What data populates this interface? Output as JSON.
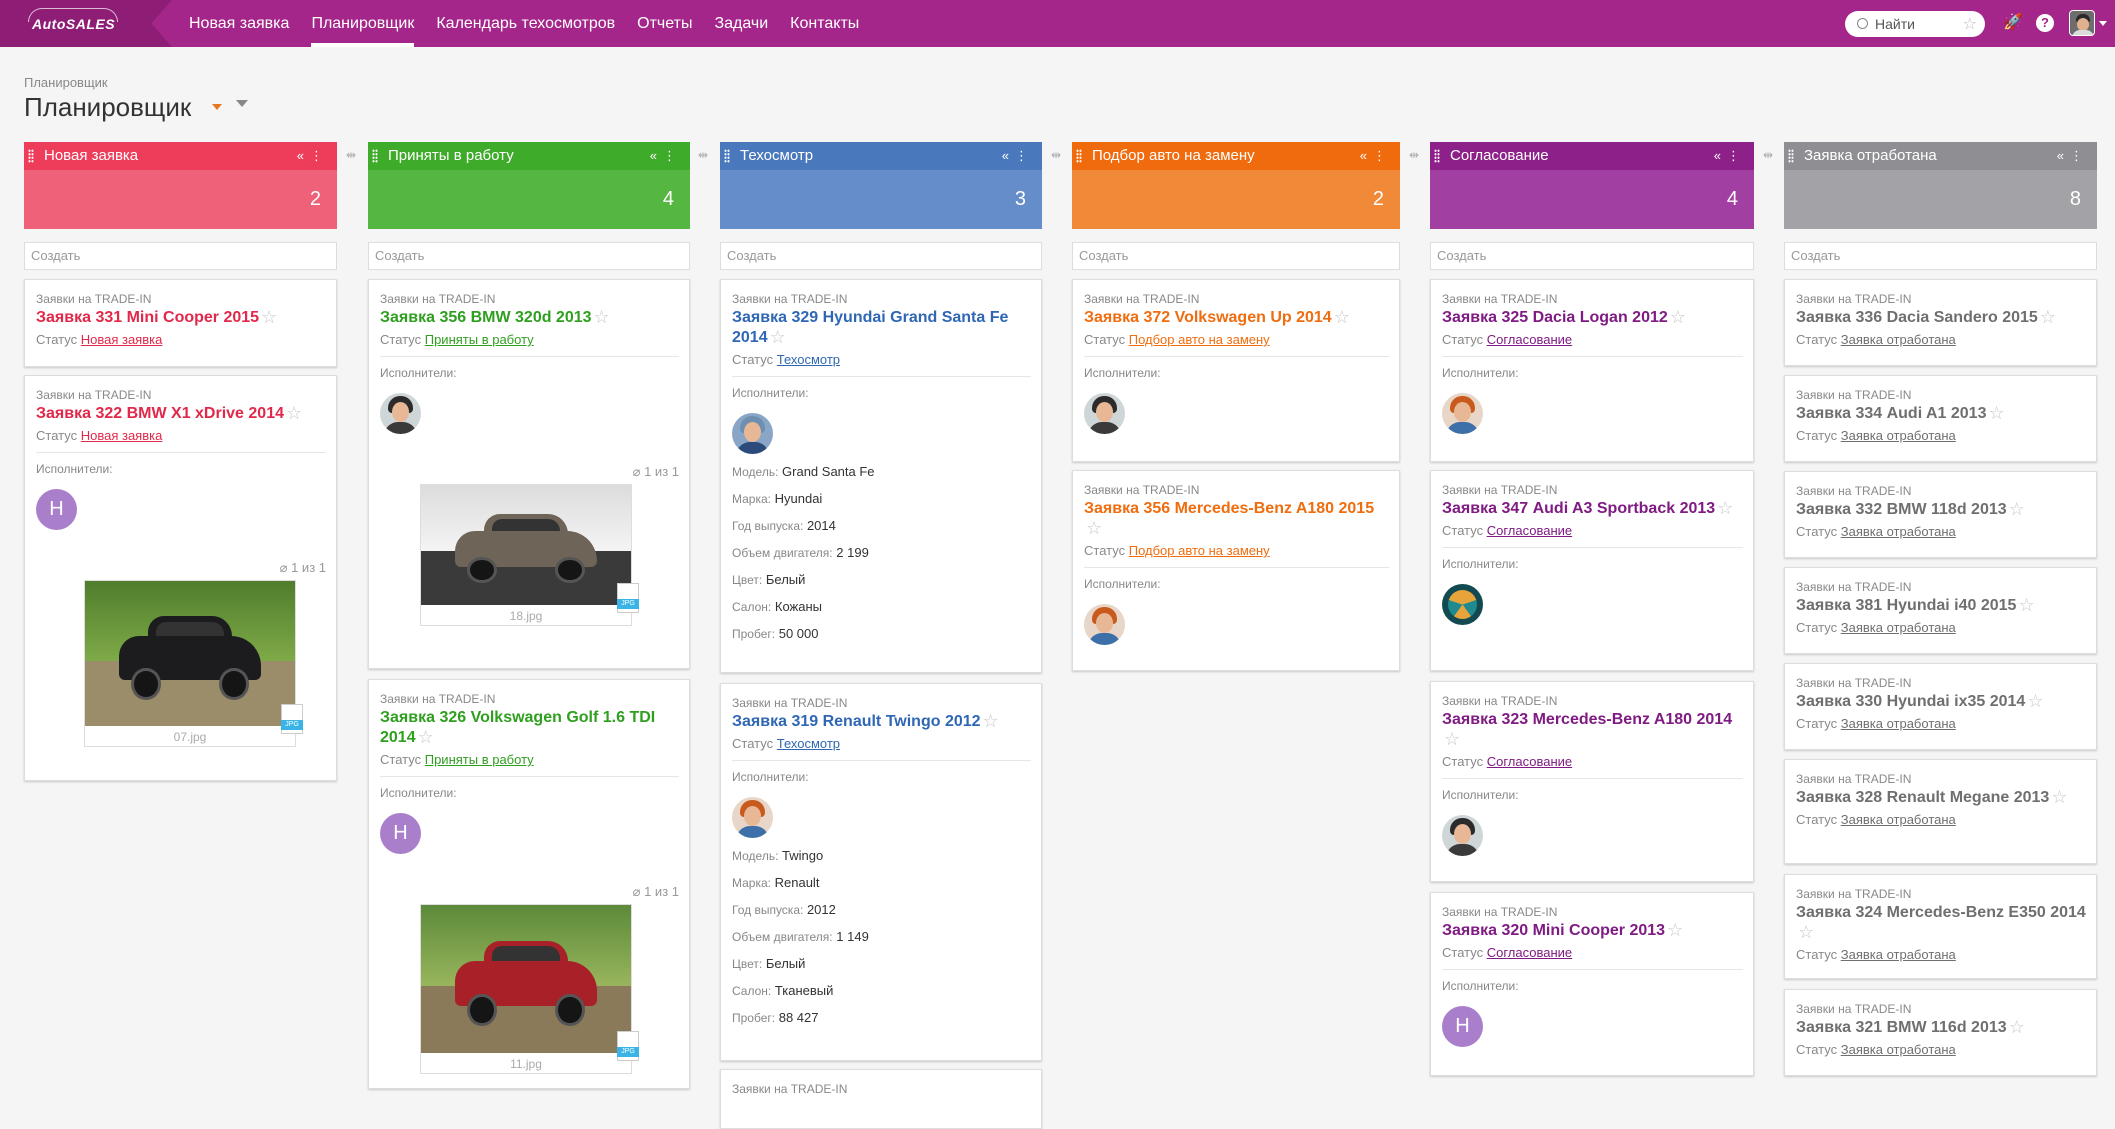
{
  "app": {
    "logo": "AutoSALES"
  },
  "nav": [
    "Новая заявка",
    "Планировщик",
    "Календарь техосмотров",
    "Отчеты",
    "Задачи",
    "Контакты"
  ],
  "search": {
    "label": "Найти"
  },
  "page": {
    "breadcrumb": "Планировщик",
    "title": "Планировщик"
  },
  "create_label": "Создать",
  "labels": {
    "status": "Статус",
    "executors": "Исполнители:",
    "model": "Модель:",
    "brand": "Марка:",
    "year": "Год выпуска:",
    "engine": "Объем двигателя:",
    "color": "Цвет:",
    "salon": "Салон:",
    "mileage": "Пробег:"
  },
  "columns": [
    {
      "title": "Новая заявка",
      "count": "2",
      "color": "#ee3d5a",
      "count_bg": "#ef6079",
      "text": "#e2284a",
      "cards": [
        {
          "kicker": "Заявки на TRADE-IN",
          "title": "Заявка 331 Mini Cooper 2015",
          "status": "Новая заявка"
        },
        {
          "kicker": "Заявки на TRADE-IN",
          "title": "Заявка 322 BMW X1 xDrive 2014",
          "status": "Новая заявка",
          "executors": true,
          "avatar": "H",
          "attach": "1 из 1",
          "file": "07.jpg"
        }
      ]
    },
    {
      "title": "Приняты в работу",
      "count": "4",
      "color": "#3fab2a",
      "count_bg": "#55b741",
      "text": "#2f9f1f",
      "cards": [
        {
          "kicker": "Заявки на TRADE-IN",
          "title": "Заявка 356 BMW 320d 2013",
          "status": "Приняты в работу",
          "executors": true,
          "attach": "1 из 1",
          "file": "18.jpg"
        },
        {
          "kicker": "Заявки на TRADE-IN",
          "title": "Заявка 326 Volkswagen Golf 1.6 TDI 2014",
          "status": "Приняты в работу",
          "executors": true,
          "avatar": "H",
          "attach": "1 из 1",
          "file": "11.jpg"
        }
      ]
    },
    {
      "title": "Техосмотр",
      "count": "3",
      "color": "#4a78bd",
      "count_bg": "#648dca",
      "text": "#2f67b5",
      "cards": [
        {
          "kicker": "Заявки на TRADE-IN",
          "title": "Заявка 329 Hyundai Grand Santa Fe 2014",
          "status": "Техосмотр",
          "executors": true,
          "fields": {
            "model": "Grand Santa Fe",
            "brand": "Hyundai",
            "year": "2014",
            "engine": "2 199",
            "color": "Белый",
            "salon": "Кожаны",
            "mileage": "50 000"
          }
        },
        {
          "kicker": "Заявки на TRADE-IN",
          "title": "Заявка 319 Renault Twingo 2012",
          "status": "Техосмотр",
          "executors": true,
          "fields": {
            "model": "Twingo",
            "brand": "Renault",
            "year": "2012",
            "engine": "1 149",
            "color": "Белый",
            "salon": "Тканевый",
            "mileage": "88 427"
          }
        },
        {
          "kicker": "Заявки на TRADE-IN"
        }
      ]
    },
    {
      "title": "Подбор авто на замену",
      "count": "2",
      "color": "#f06b0e",
      "count_bg": "#f08a38",
      "text": "#ef6d0f",
      "cards": [
        {
          "kicker": "Заявки на TRADE-IN",
          "title": "Заявка 372 Volkswagen Up 2014",
          "status": "Подбор авто на замену",
          "executors": true
        },
        {
          "kicker": "Заявки на TRADE-IN",
          "title": "Заявка 356 Mercedes-Benz A180 2015",
          "status": "Подбор авто на замену",
          "executors": true
        }
      ]
    },
    {
      "title": "Согласование",
      "count": "4",
      "color": "#8e2089",
      "count_bg": "#a23fa2",
      "text": "#7f1b82",
      "cards": [
        {
          "kicker": "Заявки на TRADE-IN",
          "title": "Заявка 325 Dacia Logan 2012",
          "status": "Согласование",
          "executors": true
        },
        {
          "kicker": "Заявки на TRADE-IN",
          "title": "Заявка 347 Audi A3 Sportback 2013",
          "status": "Согласование",
          "executors": true
        },
        {
          "kicker": "Заявки на TRADE-IN",
          "title": "Заявка 323 Mercedes-Benz A180 2014",
          "status": "Согласование",
          "executors": true
        },
        {
          "kicker": "Заявки на TRADE-IN",
          "title": "Заявка 320 Mini Cooper 2013",
          "status": "Согласование",
          "executors": true,
          "avatar": "H"
        }
      ]
    },
    {
      "title": "Заявка отработана",
      "count": "8",
      "color": "#8f8f93",
      "count_bg": "#a3a3a7",
      "text": "#6f6f6f",
      "cards": [
        {
          "kicker": "Заявки на TRADE-IN",
          "title": "Заявка 336 Dacia Sandero 2015",
          "status": "Заявка отработана"
        },
        {
          "kicker": "Заявки на TRADE-IN",
          "title": "Заявка 334 Audi A1 2013",
          "status": "Заявка отработана"
        },
        {
          "kicker": "Заявки на TRADE-IN",
          "title": "Заявка 332 BMW 118d 2013",
          "status": "Заявка отработана"
        },
        {
          "kicker": "Заявки на TRADE-IN",
          "title": "Заявка 381 Hyundai i40 2015",
          "status": "Заявка отработана"
        },
        {
          "kicker": "Заявки на TRADE-IN",
          "title": "Заявка 330 Hyundai ix35 2014",
          "status": "Заявка отработана"
        },
        {
          "kicker": "Заявки на TRADE-IN",
          "title": "Заявка 328 Renault Megane 2013",
          "status": "Заявка отработана"
        },
        {
          "kicker": "Заявки на TRADE-IN",
          "title": "Заявка 324 Mercedes-Benz E350 2014",
          "status": "Заявка отработана"
        },
        {
          "kicker": "Заявки на TRADE-IN",
          "title": "Заявка 321 BMW 116d 2013",
          "status": "Заявка отработана"
        }
      ]
    }
  ]
}
